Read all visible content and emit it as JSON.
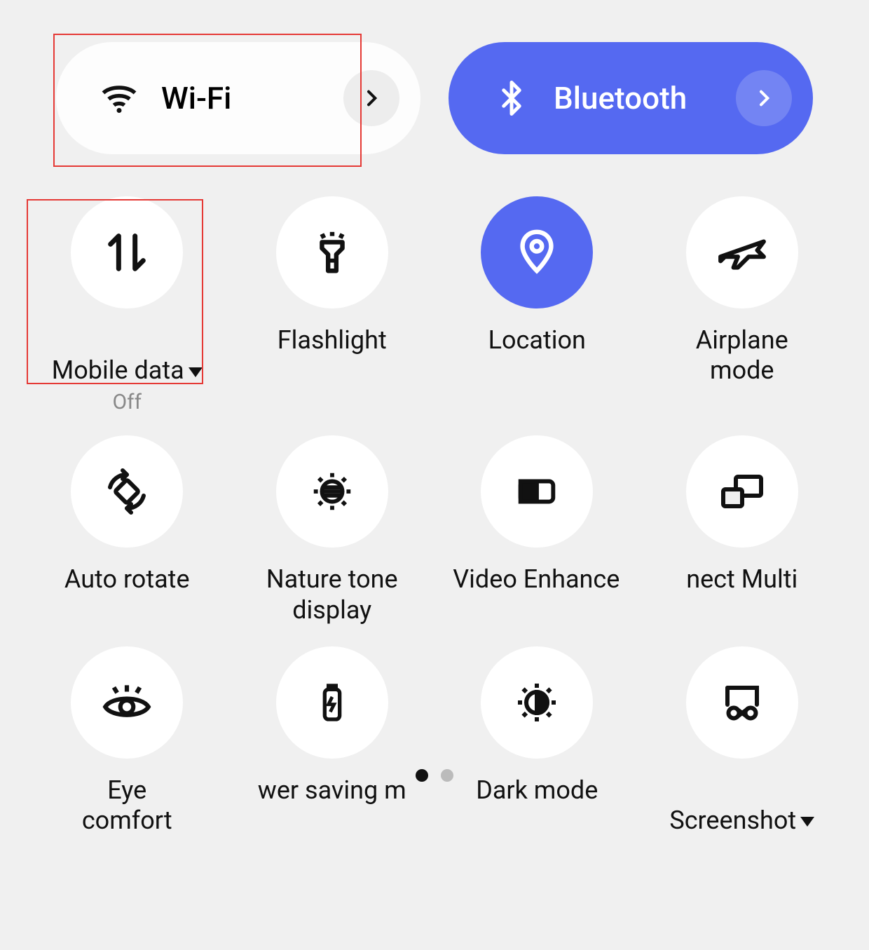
{
  "pills": {
    "wifi": {
      "label": "Wi-Fi",
      "active": false
    },
    "bluetooth": {
      "label": "Bluetooth",
      "active": true
    }
  },
  "tiles": [
    {
      "id": "mobile-data",
      "label": "Mobile data",
      "sub": "Off",
      "dropdown": true,
      "active": false
    },
    {
      "id": "flashlight",
      "label": "Flashlight",
      "sub": "",
      "dropdown": false,
      "active": false
    },
    {
      "id": "location",
      "label": "Location",
      "sub": "",
      "dropdown": false,
      "active": true
    },
    {
      "id": "airplane",
      "label": "Airplane\nmode",
      "sub": "",
      "dropdown": false,
      "active": false
    },
    {
      "id": "auto-rotate",
      "label": "Auto rotate",
      "sub": "",
      "dropdown": false,
      "active": false
    },
    {
      "id": "nature-tone",
      "label": "Nature tone\ndisplay",
      "sub": "",
      "dropdown": false,
      "active": false
    },
    {
      "id": "video-enhance",
      "label": "Video Enhancer",
      "sub": "",
      "dropdown": false,
      "active": false,
      "clipped": true
    },
    {
      "id": "multi-connect",
      "label": "nect     Multi",
      "sub": "",
      "dropdown": false,
      "active": false,
      "clipped": true
    },
    {
      "id": "eye-comfort",
      "label": "Eye\ncomfort",
      "sub": "",
      "dropdown": false,
      "active": false
    },
    {
      "id": "power-saving",
      "label": "Power saving mode",
      "sub": "",
      "dropdown": false,
      "active": false,
      "clipped": true,
      "clippedText": "wer saving m"
    },
    {
      "id": "dark-mode",
      "label": "Dark mode",
      "sub": "",
      "dropdown": false,
      "active": false
    },
    {
      "id": "screenshot",
      "label": "Screenshot",
      "sub": "",
      "dropdown": true,
      "active": false
    }
  ],
  "pagination": {
    "pages": 2,
    "current": 0
  },
  "colors": {
    "accent": "#5569f1",
    "highlight": "#e53935"
  }
}
